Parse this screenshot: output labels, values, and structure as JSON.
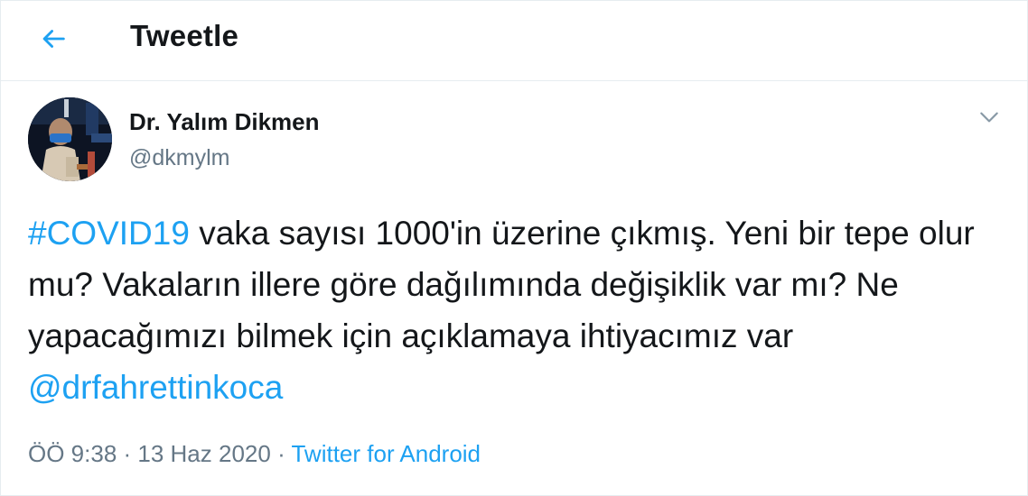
{
  "header": {
    "title": "Tweetle",
    "back_icon": "arrow-left-icon"
  },
  "tweet": {
    "author": {
      "name": "Dr. Yalım Dikmen",
      "handle": "@dkmylm"
    },
    "menu_icon": "chevron-down-icon",
    "text": {
      "hashtag": "#COVID19",
      "body": " vaka sayısı 1000'in üzerine çıkmış. Yeni bir tepe olur mu? Vakaların illere göre dağılımında değişiklik var mı? Ne yapacağımızı bilmek için açıklamaya ihtiyacımız var ",
      "mention": "@drfahrettinkoca"
    },
    "meta": {
      "time": "ÖÖ 9:38",
      "separator1": " · ",
      "date": "13 Haz 2020",
      "separator2": " · ",
      "source": "Twitter for Android"
    }
  },
  "colors": {
    "accent": "#1da1f2",
    "text": "#14171a",
    "muted": "#657786",
    "border": "#e6ecf0"
  }
}
